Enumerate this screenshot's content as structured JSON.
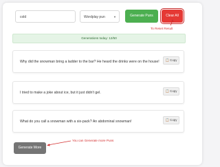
{
  "form": {
    "topic_value": "cold",
    "style_value": "Wordplay pun",
    "generate_label": "Generate Puns",
    "clear_label": "Clear All"
  },
  "status": {
    "generations_text": "Generations today: 12/50"
  },
  "annotations": {
    "reset_hint": "To Reset Result",
    "more_hint": "You can Generate more Puns"
  },
  "jokes": [
    {
      "text": "Why did the snowman bring a ladder to the bar? He heard the drinks were on the house!",
      "copy_label": "Copy"
    },
    {
      "text": "I tried to make a joke about ice, but it just didn't gel.",
      "copy_label": "Copy"
    },
    {
      "text": "What do you call a snowman with a six-pack? An abdominal snowman!",
      "copy_label": "Copy"
    }
  ],
  "footer": {
    "generate_more_label": "Generate More"
  },
  "colors": {
    "generate": "#4caf50",
    "clear": "#e53935",
    "annotation": "#d32f2f",
    "banner_bg": "#e5f4e6",
    "more_button": "#757575"
  }
}
